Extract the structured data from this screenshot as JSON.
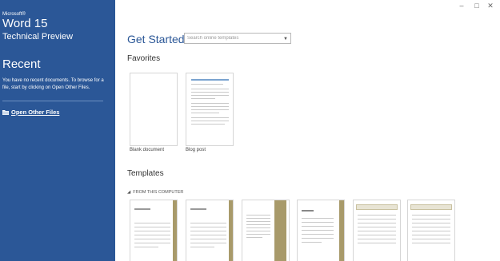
{
  "app": {
    "brand_small": "Microsoft®",
    "brand_name": "Word 15",
    "brand_subtitle": "Technical Preview",
    "sidebar_color": "#2b5797"
  },
  "recent": {
    "heading": "Recent",
    "empty_message": "You have no recent documents. To browse for a file, start by clicking on Open Other Files.",
    "open_other_label": "Open Other Files",
    "open_other_icon": "folder-icon"
  },
  "window_controls": {
    "minimize": "–",
    "restore": "□",
    "close": "✕"
  },
  "main": {
    "title": "Get Started",
    "search_placeholder": "Search online templates",
    "favorites_heading": "Favorites",
    "favorites": [
      {
        "label": "Blank document"
      },
      {
        "label": "Blog post"
      }
    ],
    "templates_heading": "Templates",
    "templates_group": "FROM THIS COMPUTER",
    "accent_tan": "#a89a6a"
  }
}
